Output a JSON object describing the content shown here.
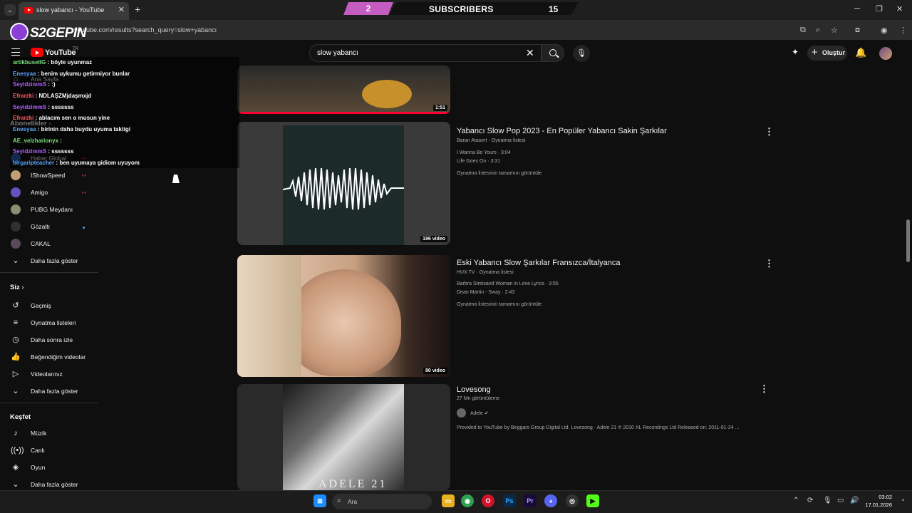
{
  "browser": {
    "tab_title": "slow yabancı - YouTube",
    "url": "youtube.com/results?search_query=slow+yabancı"
  },
  "overlay": {
    "logo_text": "S2GEPIN",
    "subscribers_count": "2",
    "subscribers_label": "SUBSCRIBERS",
    "subscribers_goal": "15"
  },
  "youtube": {
    "logo_text": "YouTube",
    "region": "TR",
    "search_value": "slow yabancı",
    "create_label": "Oluştur"
  },
  "sidebar": {
    "top_items": [
      {
        "label": "Ana Sayfa",
        "icon": "home-icon"
      }
    ],
    "subscriptions_header": "Abonelikler",
    "channels": [
      {
        "label": "Haber Global",
        "live": true,
        "color": "#2a5db0"
      },
      {
        "label": "IShowSpeed",
        "live": true,
        "color": "#c0a070"
      },
      {
        "label": "Amigo",
        "live": true,
        "color": "#6a4fc0"
      },
      {
        "label": "PUBG Meydanı",
        "live": false,
        "color": "#8a8f70"
      },
      {
        "label": "Gözaltı",
        "live": false,
        "dot": true,
        "color": "#303030"
      },
      {
        "label": "CAKAL",
        "live": false,
        "color": "#5a4a5a"
      }
    ],
    "show_more_1": "Daha fazla göster",
    "you_header": "Siz",
    "you_items": [
      {
        "label": "Geçmiş",
        "icon": "history-icon"
      },
      {
        "label": "Oynatma listeleri",
        "icon": "playlists-icon"
      },
      {
        "label": "Daha sonra izle",
        "icon": "watch-later-icon"
      },
      {
        "label": "Beğendiğim videolar",
        "icon": "like-icon"
      },
      {
        "label": "Videolarınız",
        "icon": "your-videos-icon"
      }
    ],
    "show_more_2": "Daha fazla göster",
    "explore_header": "Keşfet",
    "explore_items": [
      {
        "label": "Müzik",
        "icon": "music-icon"
      },
      {
        "label": "Canlı",
        "icon": "live-icon"
      },
      {
        "label": "Oyun",
        "icon": "gaming-icon"
      }
    ],
    "show_more_3": "Daha fazla göster"
  },
  "chat": [
    {
      "user": "artikbuselIG",
      "msg": ": böyle uyunmaz",
      "color": "#7de07d"
    },
    {
      "user": "Enesyaa",
      "msg": ": benim uykumu getirmiyor bunlar",
      "color": "#5aa7ff"
    },
    {
      "user": "SeyidzimmS",
      "msg": ": :)",
      "color": "#b060ff"
    },
    {
      "user": "Efrarzki",
      "msg": ": NDLAŞZMjdaşmxjd",
      "color": "#ff5a5a"
    },
    {
      "user": "SeyidzimmS",
      "msg": ": sssssss",
      "color": "#b060ff"
    },
    {
      "user": "Efrarzki",
      "msg": ": ablacım sen o musun yine",
      "color": "#ff5a5a"
    },
    {
      "user": "Enesyaa",
      "msg": ": birinin daha buydu uyuma taktigi",
      "color": "#5aa7ff"
    },
    {
      "user": "AE_velzharionyx",
      "msg": ":",
      "color": "#7de07d"
    },
    {
      "user": "SeyidzimmS",
      "msg": ": sssssss",
      "color": "#b060ff"
    },
    {
      "user": "birgaripteacher",
      "msg": ": ben uyumaya gidiom uyuyom",
      "color": "#5aa7ff"
    }
  ],
  "results": [
    {
      "duration": "1:51"
    },
    {
      "title": "Yabancı Slow Pop 2023 - En Popüler Yabancı Sakin Şarkılar",
      "channel": "Baran Atasert",
      "type": "Oynatma listesi",
      "songs": [
        "I Wanna Be Yours · 3:04",
        "Life Goes On · 3:31"
      ],
      "view_all": "Oynatma listesinin tamamını görüntüle",
      "count": "196 video"
    },
    {
      "title": "Eski Yabancı Slow Şarkılar Fransızca/İtalyanca",
      "channel": "HUX TV",
      "type": "Oynatma listesi",
      "songs": [
        "Barbra Streisand Woman in Love Lyrics · 3:55",
        "Dean Martin - Sway · 2:43"
      ],
      "view_all": "Oynatma listesinin tamamını görüntüle",
      "count": "80 video"
    },
    {
      "title": "Lovesong",
      "views": "27 Mn görüntüleme",
      "channel": "Adele",
      "description": "Provided to YouTube by Beggars Group Digital Ltd. Lovesong · Adele 21 ℗ 2010 XL Recordings Ltd Released on: 2011-01-24 ...",
      "thumb_text": "ADELE 21"
    }
  ],
  "taskbar": {
    "search_label": "Ara",
    "time": "03:02",
    "date": "17.01.2026"
  },
  "colors": {
    "background": "#0f0f0f",
    "accent_red": "#ff0000",
    "banner_pink": "#c45cc2"
  }
}
